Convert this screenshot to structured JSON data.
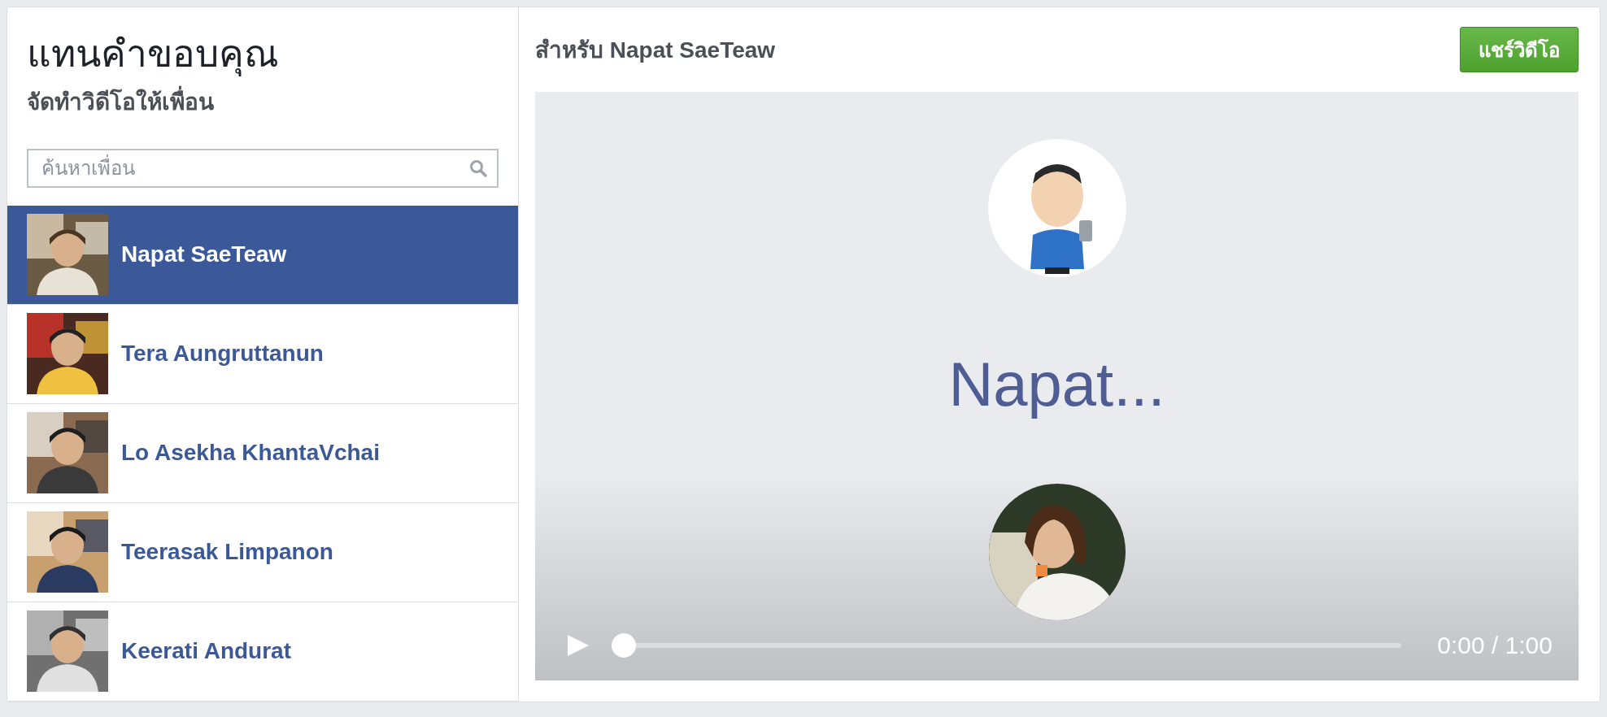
{
  "sidebar": {
    "title": "แทนคำขอบคุณ",
    "subtitle": "จัดทำวิดีโอให้เพื่อน",
    "search": {
      "placeholder": "ค้นหาเพื่อน"
    },
    "friends": [
      {
        "name": "Napat SaeTeaw",
        "selected": true
      },
      {
        "name": "Tera Aungruttanun",
        "selected": false
      },
      {
        "name": "Lo Asekha KhantaVchai",
        "selected": false
      },
      {
        "name": "Teerasak Limpanon",
        "selected": false
      },
      {
        "name": "Keerati Andurat",
        "selected": false
      }
    ]
  },
  "preview": {
    "title": "สำหรับ Napat SaeTeaw",
    "share_button": "แชร์วิดีโอ",
    "video": {
      "headline": "Napat...",
      "time": "0:00 / 1:00",
      "level": 0
    }
  }
}
